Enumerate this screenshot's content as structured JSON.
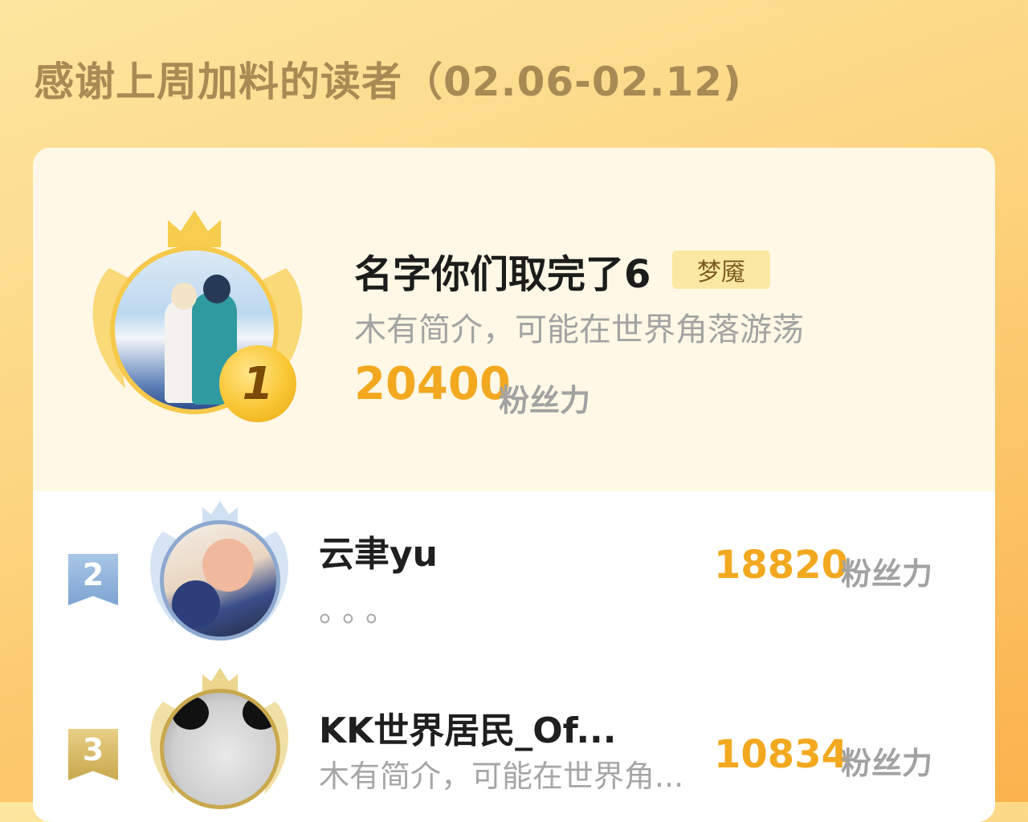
{
  "header": {
    "title": "感谢上周加料的读者（02.06-02.12)"
  },
  "colors": {
    "score": "#f2a81f",
    "gold": "#f6c94b",
    "silver": "#8ea9cf",
    "bronze": "#c9a84e"
  },
  "ranking": [
    {
      "rank": "1",
      "name": "名字你们取完了6",
      "badge": "梦魇",
      "intro": "木有简介，可能在世界角落游荡",
      "score": "20400",
      "unit": "粉丝力"
    },
    {
      "rank": "2",
      "name": "云聿yu",
      "intro": "。。。",
      "score": "18820",
      "unit": "粉丝力"
    },
    {
      "rank": "3",
      "name": "KK世界居民_Of...",
      "intro": "木有简介，可能在世界角...",
      "score": "10834",
      "unit": "粉丝力"
    }
  ]
}
